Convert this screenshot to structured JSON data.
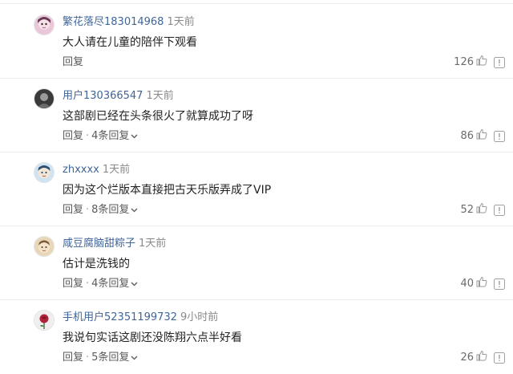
{
  "comments": [
    {
      "username": "繁花落尽183014968",
      "time": "1天前",
      "content": "大人请在儿童的陪伴下观看",
      "reply_label": "回复",
      "sep": "",
      "replies_label": "",
      "likes": "126",
      "avatar_icon": "avatar-girl-icon",
      "avatar_colors": [
        "#e9c6d8",
        "#6b3a55"
      ]
    },
    {
      "username": "用户130366547",
      "time": "1天前",
      "content": "这部剧已经在头条很火了就算成功了呀",
      "reply_label": "回复",
      "sep": "·",
      "replies_label": "4条回复",
      "likes": "86",
      "avatar_icon": "avatar-dark-icon",
      "avatar_colors": [
        "#3a3a3a",
        "#9a9a9a"
      ]
    },
    {
      "username": "zhxxxx",
      "time": "1天前",
      "content": "因为这个烂版本直接把古天乐版弄成了VIP",
      "reply_label": "回复",
      "sep": "·",
      "replies_label": "8条回复",
      "likes": "52",
      "avatar_icon": "avatar-cartoon-icon",
      "avatar_colors": [
        "#cfe3f3",
        "#2f4f6f"
      ]
    },
    {
      "username": "咸豆腐脑甜粽子",
      "time": "1天前",
      "content": "估计是洗钱的",
      "reply_label": "回复",
      "sep": "·",
      "replies_label": "4条回复",
      "likes": "40",
      "avatar_icon": "avatar-child-icon",
      "avatar_colors": [
        "#e8d6b8",
        "#7a5a3a"
      ]
    },
    {
      "username": "手机用户52351199732",
      "time": "9小时前",
      "content": "我说句实话这剧还没陈翔六点半好看",
      "reply_label": "回复",
      "sep": "·",
      "replies_label": "5条回复",
      "likes": "26",
      "avatar_icon": "avatar-rose-icon",
      "avatar_colors": [
        "#f1eef0",
        "#b0223a"
      ]
    }
  ],
  "colors": {
    "username": "#406599",
    "text": "#222222",
    "muted": "#8a8a8a",
    "divider": "#ececec"
  },
  "icons": {
    "like": "thumbs-up-icon",
    "report": "report-icon",
    "expand": "chevron-down-icon"
  }
}
